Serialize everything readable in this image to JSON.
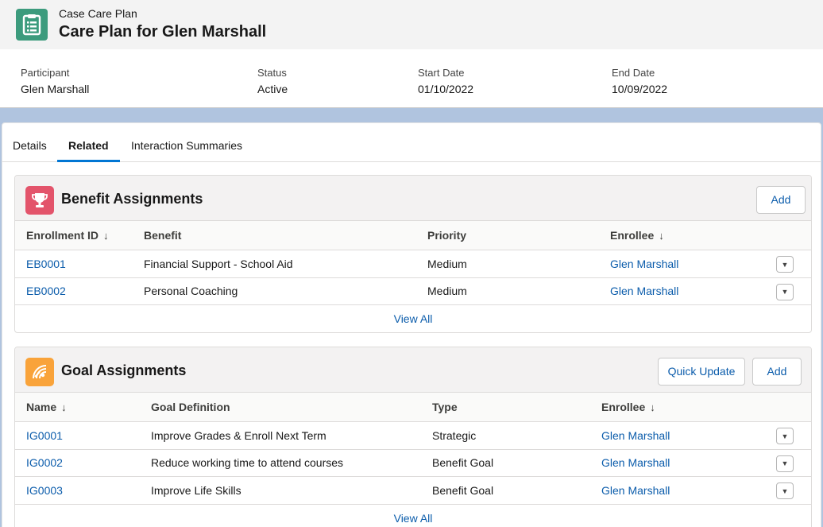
{
  "header": {
    "object_type": "Case Care Plan",
    "record_name": "Care Plan for Glen Marshall",
    "icon": "clipboard-list-icon",
    "icon_color": "#3c9b7d"
  },
  "highlights": {
    "participant_label": "Participant",
    "participant_value": "Glen Marshall",
    "status_label": "Status",
    "status_value": "Active",
    "start_label": "Start Date",
    "start_value": "01/10/2022",
    "end_label": "End Date",
    "end_value": "10/09/2022"
  },
  "tabs": [
    {
      "label": "Details",
      "active": false
    },
    {
      "label": "Related",
      "active": true
    },
    {
      "label": "Interaction Summaries",
      "active": false
    }
  ],
  "benefit_assignments": {
    "title": "Benefit Assignments",
    "icon": "trophy-icon",
    "icon_color": "#e3546b",
    "add_label": "Add",
    "columns": [
      "Enrollment ID",
      "Benefit",
      "Priority",
      "Enrollee"
    ],
    "sort_indicator": "↓",
    "rows": [
      {
        "id": "EB0001",
        "benefit": "Financial Support - School Aid",
        "priority": "Medium",
        "enrollee": "Glen Marshall"
      },
      {
        "id": "EB0002",
        "benefit": "Personal Coaching",
        "priority": "Medium",
        "enrollee": "Glen Marshall"
      }
    ],
    "view_all": "View All"
  },
  "goal_assignments": {
    "title": "Goal Assignments",
    "icon": "target-signal-icon",
    "icon_color": "#f9a33a",
    "quick_update_label": "Quick Update",
    "add_label": "Add",
    "columns": [
      "Name",
      "Goal Definition",
      "Type",
      "Enrollee"
    ],
    "sort_indicator": "↓",
    "rows": [
      {
        "id": "IG0001",
        "goal": "Improve Grades & Enroll Next Term",
        "type": "Strategic",
        "enrollee": "Glen Marshall"
      },
      {
        "id": "IG0002",
        "goal": "Reduce working time to attend courses",
        "type": "Benefit Goal",
        "enrollee": "Glen Marshall"
      },
      {
        "id": "IG0003",
        "goal": "Improve Life Skills",
        "type": "Benefit Goal",
        "enrollee": "Glen Marshall"
      }
    ],
    "view_all": "View All"
  }
}
